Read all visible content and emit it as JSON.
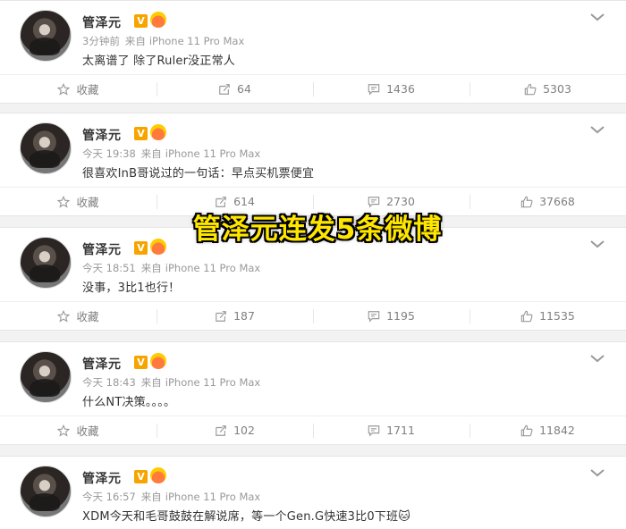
{
  "user": {
    "name": "管泽元",
    "verified_badge": "V"
  },
  "source_prefix": "来自",
  "posts": [
    {
      "time": "3分钟前",
      "device": "iPhone 11 Pro Max",
      "text": "太离谱了 除了Ruler没正常人",
      "actions": {
        "favorite": "收藏",
        "repost": "64",
        "comment": "1436",
        "like": "5303"
      }
    },
    {
      "time": "今天 19:38",
      "device": "iPhone 11 Pro Max",
      "text": "很喜欢InB哥说过的一句话：早点买机票便宜",
      "actions": {
        "favorite": "收藏",
        "repost": "614",
        "comment": "2730",
        "like": "37668"
      }
    },
    {
      "time": "今天 18:51",
      "device": "iPhone 11 Pro Max",
      "text": "没事，3比1也行！",
      "actions": {
        "favorite": "收藏",
        "repost": "187",
        "comment": "1195",
        "like": "11535"
      }
    },
    {
      "time": "今天 18:43",
      "device": "iPhone 11 Pro Max",
      "text": "什么NT决策。。。。",
      "actions": {
        "favorite": "收藏",
        "repost": "102",
        "comment": "1711",
        "like": "11842"
      }
    },
    {
      "time": "今天 16:57",
      "device": "iPhone 11 Pro Max",
      "text": "XDM今天和毛哥鼓鼓在解说席，等一个Gen.G快速3比0下班🐱",
      "actions": {
        "favorite": "收藏",
        "repost": "",
        "comment": "",
        "like": ""
      }
    }
  ],
  "overlay_caption": "管泽元连发5条微博",
  "colors": {
    "badge": "#f7a400",
    "caption": "#ffe600",
    "meta": "#999999",
    "action": "#808080"
  }
}
